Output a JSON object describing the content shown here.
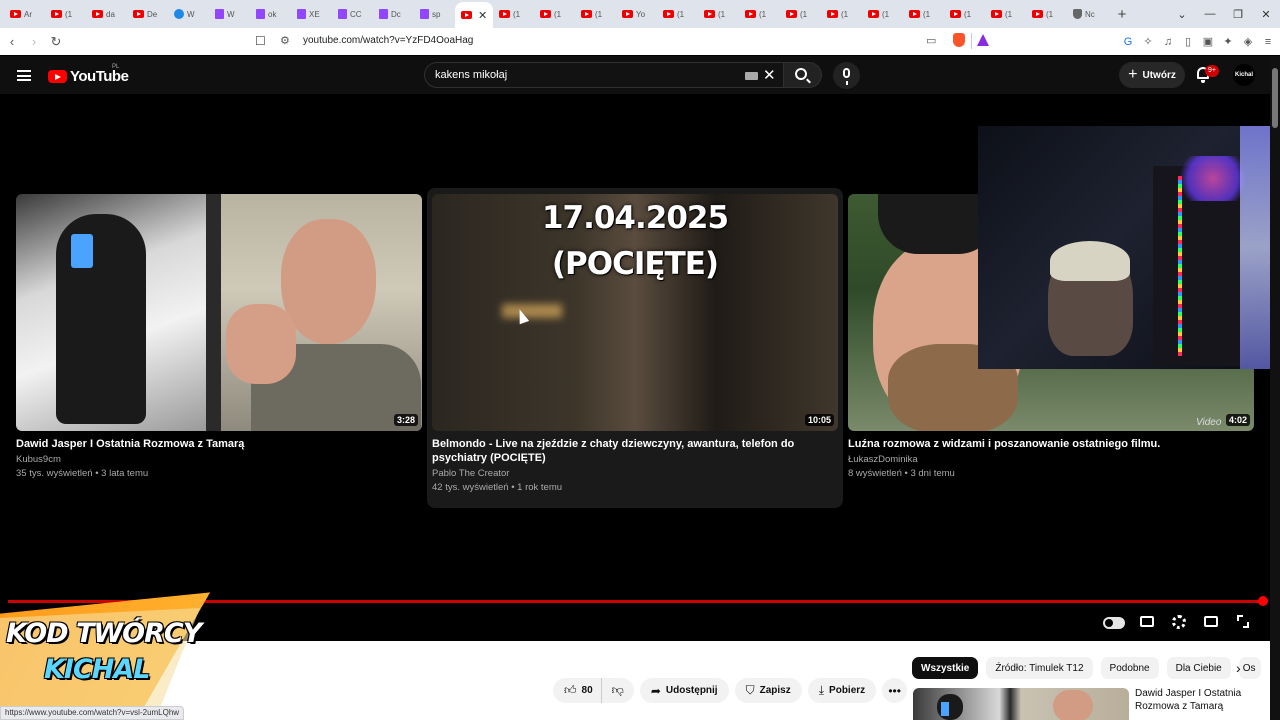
{
  "browser": {
    "tabs": [
      {
        "icon": "youtube-icon",
        "label": "Ar"
      },
      {
        "icon": "youtube-icon",
        "label": "(1"
      },
      {
        "icon": "youtube-icon",
        "label": "da"
      },
      {
        "icon": "youtube-icon",
        "label": "De"
      },
      {
        "icon": "adblock-icon",
        "label": "W"
      },
      {
        "icon": "twitch-icon",
        "label": "W"
      },
      {
        "icon": "twitch-icon",
        "label": "ok"
      },
      {
        "icon": "twitch-icon",
        "label": "XE"
      },
      {
        "icon": "twitch-icon",
        "label": "CC"
      },
      {
        "icon": "twitch-icon",
        "label": "Dc"
      },
      {
        "icon": "twitch-icon",
        "label": "sp"
      },
      {
        "icon": "youtube-icon",
        "label": "",
        "active": true
      },
      {
        "icon": "youtube-icon",
        "label": "(1"
      },
      {
        "icon": "youtube-icon",
        "label": "(1"
      },
      {
        "icon": "youtube-icon",
        "label": "(1"
      },
      {
        "icon": "youtube-icon",
        "label": "Yo"
      },
      {
        "icon": "youtube-icon",
        "label": "(1"
      },
      {
        "icon": "youtube-icon",
        "label": "(1"
      },
      {
        "icon": "youtube-icon",
        "label": "(1"
      },
      {
        "icon": "youtube-icon",
        "label": "(1"
      },
      {
        "icon": "youtube-icon",
        "label": "(1"
      },
      {
        "icon": "youtube-icon",
        "label": "(1"
      },
      {
        "icon": "youtube-icon",
        "label": "(1"
      },
      {
        "icon": "youtube-icon",
        "label": "(1"
      },
      {
        "icon": "youtube-icon",
        "label": "(1"
      },
      {
        "icon": "youtube-icon",
        "label": "(1"
      },
      {
        "icon": "shield-icon",
        "label": "Nc"
      }
    ],
    "active_tab_close": "✕",
    "new_tab": "+",
    "window_controls": [
      "⌄",
      "—",
      "❐",
      "✕"
    ],
    "url": "youtube.com/watch?v=YzFD4OoaHag",
    "status_url": "https://www.youtube.com/watch?v=vsl-2umLQhw"
  },
  "youtube": {
    "logo_text": "YouTube",
    "country_code": "PL",
    "search_value": "kakens mikołaj",
    "create_label": "Utwórz",
    "notif_count": "9+",
    "avatar_text": "Kichal"
  },
  "endscreen": {
    "videos": [
      {
        "title": "Dawid Jasper I Ostatnia Rozmowa z Tamarą",
        "channel": "Kubus9cm",
        "meta": "35 tys. wyświetleń • 3 lata temu",
        "duration": "3:28"
      },
      {
        "title": "Belmondo - Live na zjeździe z chaty dziewczyny, awantura, telefon do psychiatry (POCIĘTE)",
        "channel": "Pablo The Creator",
        "meta": "42 tys. wyświetleń • 1 rok temu",
        "duration": "10:05",
        "overlay_date": "17.04.2025",
        "overlay_note": "(POCIĘTE)"
      },
      {
        "title": "Luźna rozmowa z widzami i poszanowanie ostatniego filmu.",
        "channel": "ŁukaszDominika",
        "meta": "8 wyświetleń • 3 dni temu",
        "duration": "4:02",
        "watermark": "Video"
      }
    ]
  },
  "banner": {
    "line1": "KOD TWÓRCY",
    "line2": "KICHAL"
  },
  "actions": {
    "like_count": "80",
    "share": "Udostępnij",
    "save": "Zapisz",
    "download": "Pobierz"
  },
  "chips": [
    "Wszystkie",
    "Źródło: Timulek T12",
    "Podobne",
    "Dla Ciebie",
    "Os"
  ],
  "recommended": {
    "title": "Dawid Jasper I Ostatnia Rozmowa z Tamarą"
  },
  "progress": {
    "played_fraction": 1.0
  },
  "colors": {
    "yt_red": "#ff0000",
    "progress": "#cc0000",
    "banner_orange": "#ff9a1a",
    "banner_blue": "#5bd7ff"
  }
}
